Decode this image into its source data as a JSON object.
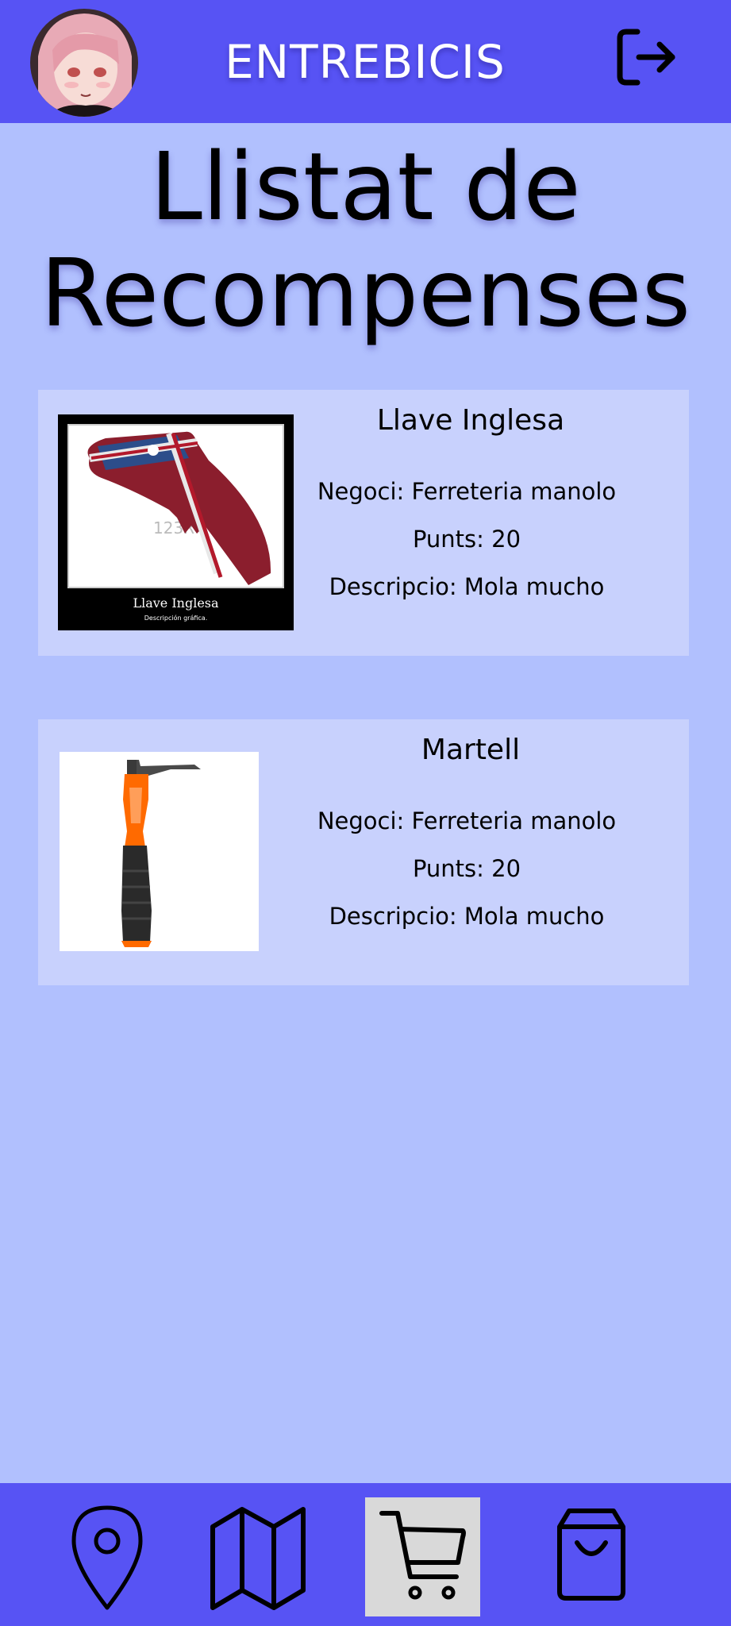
{
  "header": {
    "title": "ENTREBICIS",
    "avatar_icon": "user-avatar",
    "logout_icon": "logout-icon"
  },
  "page": {
    "title_line1": "Llistat de",
    "title_line2": "Recompenses"
  },
  "rewards": [
    {
      "name": "Llave Inglesa",
      "negoci": "Negoci:  Ferreteria manolo",
      "punts": "Punts: 20",
      "descripcio": "Descripcio: Mola mucho",
      "image_caption": "Llave Inglesa",
      "image_subcaption": "Descripción gráfica."
    },
    {
      "name": "Martell",
      "negoci": "Negoci:  Ferreteria manolo",
      "punts": "Punts: 20",
      "descripcio": "Descripcio: Mola mucho"
    }
  ],
  "nav": {
    "items": [
      {
        "icon": "location-pin-icon",
        "active": false
      },
      {
        "icon": "map-icon",
        "active": false
      },
      {
        "icon": "cart-icon",
        "active": true
      },
      {
        "icon": "shopping-bag-icon",
        "active": false
      }
    ]
  },
  "colors": {
    "header_bg": "#5753f4",
    "page_bg": "#b1c0fe",
    "card_bg": "#c8d1fd",
    "active_nav_bg": "#d9d9d9"
  }
}
